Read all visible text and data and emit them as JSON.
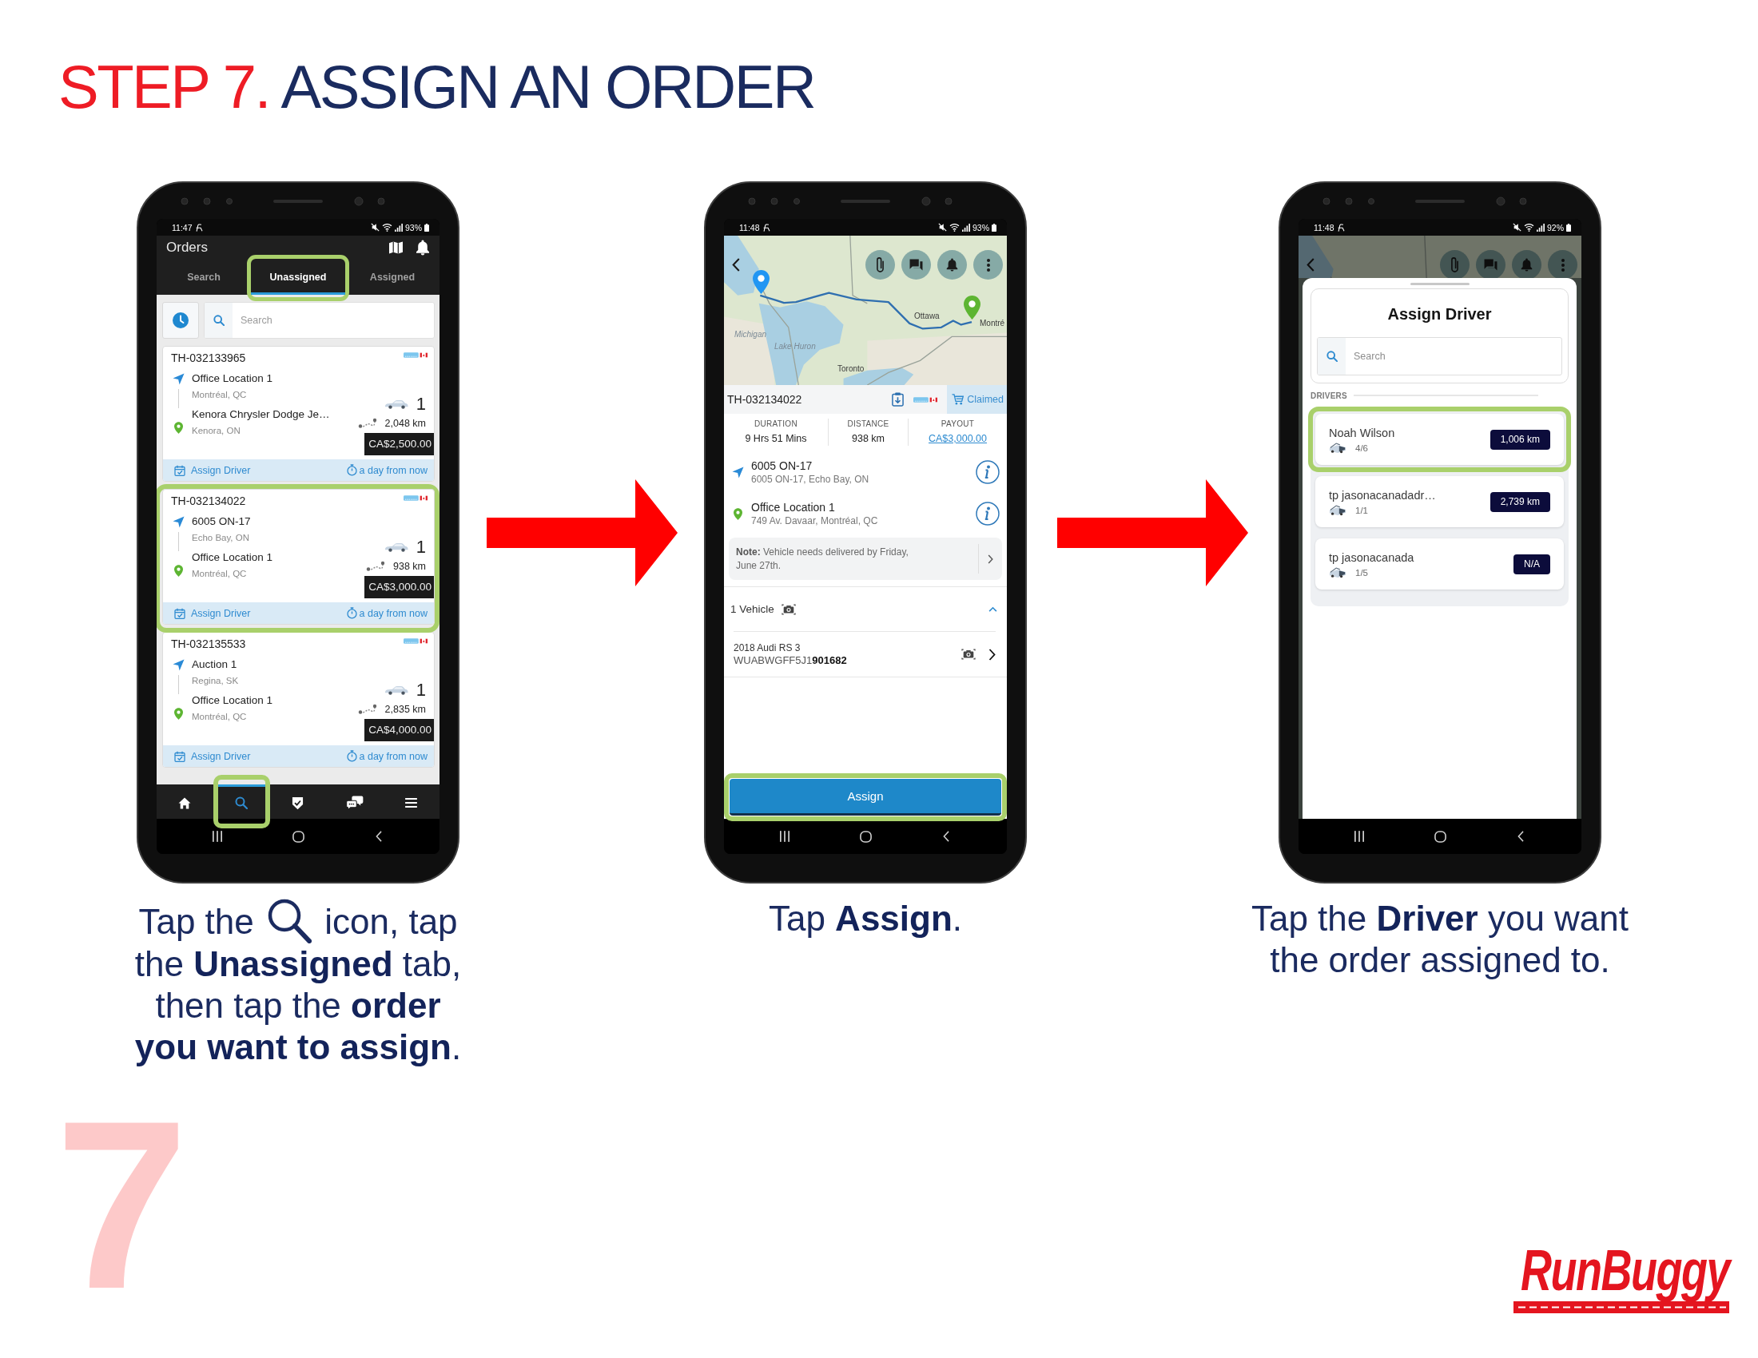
{
  "title": {
    "step": "STEP 7.",
    "text": "ASSIGN AN ORDER"
  },
  "phones": [
    {
      "kind": "orders",
      "status_bar": {
        "time": "11:47",
        "battery": "93%"
      },
      "header": {
        "title": "Orders"
      },
      "tabs": [
        {
          "label": "Search",
          "selected": false,
          "highlighted": false
        },
        {
          "label": "Unassigned",
          "selected": true,
          "highlighted": true
        },
        {
          "label": "Assigned",
          "selected": false,
          "highlighted": false
        }
      ],
      "search": {
        "placeholder": "Search"
      },
      "orders": [
        {
          "order_id": "TH-032133965",
          "pickup": {
            "name": "Office Location 1",
            "city": "Montréal, QC"
          },
          "dropoff": {
            "name": "Kenora Chrysler Dodge Je…",
            "city": "Kenora, ON"
          },
          "vehicle_count": "1",
          "distance": "2,048 km",
          "price": "CA$2,500.00",
          "action": "Assign Driver",
          "due": "a day from now",
          "highlighted": false
        },
        {
          "order_id": "TH-032134022",
          "pickup": {
            "name": "6005 ON-17",
            "city": "Echo Bay, ON"
          },
          "dropoff": {
            "name": "Office Location 1",
            "city": "Montréal, QC"
          },
          "vehicle_count": "1",
          "distance": "938 km",
          "price": "CA$3,000.00",
          "action": "Assign Driver",
          "due": "a day from now",
          "highlighted": true
        },
        {
          "order_id": "TH-032135533",
          "pickup": {
            "name": "Auction 1",
            "city": "Regina, SK"
          },
          "dropoff": {
            "name": "Office Location 1",
            "city": "Montréal, QC"
          },
          "vehicle_count": "1",
          "distance": "2,835 km",
          "price": "CA$4,000.00",
          "action": "Assign Driver",
          "due": "a day from now",
          "highlighted": false
        }
      ],
      "bottom_nav": [
        {
          "selected": false,
          "highlighted": false
        },
        {
          "selected": true,
          "highlighted": true
        },
        {
          "selected": false,
          "highlighted": false
        },
        {
          "selected": false,
          "highlighted": false
        },
        {
          "selected": false,
          "highlighted": false
        }
      ]
    },
    {
      "kind": "order_detail",
      "status_bar": {
        "time": "11:48",
        "battery": "93%"
      },
      "map": {
        "labels": [
          {
            "text": "Ottawa",
            "kind": "city"
          },
          {
            "text": "Montré",
            "kind": "city"
          },
          {
            "text": "Michigan",
            "kind": "region"
          },
          {
            "text": "Lake Huron",
            "kind": "region"
          },
          {
            "text": "Toronto",
            "kind": "city"
          }
        ]
      },
      "order": {
        "order_id": "TH-032134022",
        "status": "Claimed"
      },
      "stats": [
        {
          "label": "DURATION",
          "value": "9 Hrs 51 Mins",
          "kind": "text"
        },
        {
          "label": "DISTANCE",
          "value": "938 km",
          "kind": "text"
        },
        {
          "label": "PAYOUT",
          "value": "CA$3,000.00",
          "kind": "link"
        }
      ],
      "stops": [
        {
          "kind": "pickup",
          "name": "6005 ON-17",
          "address": "6005 ON-17, Echo Bay, ON"
        },
        {
          "kind": "dropoff",
          "name": "Office Location 1",
          "address": "749 Av. Davaar, Montréal, QC"
        }
      ],
      "note": "**Note:** Vehicle needs delivered by Friday, June 27th.",
      "vehicles": {
        "title": "1 Vehicle",
        "expanded": true,
        "items": [
          {
            "name": "2018 Audi RS 3",
            "vin": "WUABWGFF5J1**901682**"
          }
        ]
      },
      "assign_button": {
        "label": "Assign",
        "highlighted": true
      }
    },
    {
      "kind": "assign_driver",
      "status_bar": {
        "time": "11:48",
        "battery": "92%"
      },
      "sheet": {
        "title": "Assign Driver",
        "search": {
          "placeholder": "Search"
        },
        "section_label": "DRIVERS",
        "drivers": [
          {
            "name": "Noah Wilson",
            "load": "4/6",
            "distance": "1,006 km",
            "highlighted": true
          },
          {
            "name": "tp jasonacanadadr…",
            "load": "1/1",
            "distance": "2,739 km",
            "highlighted": false
          },
          {
            "name": "tp jasonacanada",
            "load": "1/5",
            "distance": "N/A",
            "highlighted": false
          }
        ]
      }
    }
  ],
  "captions": [
    {
      "kind": "with_icon",
      "before_icon": "Tap the",
      "after_icon": "icon, tap the **Unassigned** tab, then tap the **order you want to assign**."
    },
    {
      "kind": "plain",
      "text": "Tap **Assign**."
    },
    {
      "kind": "plain",
      "text": "Tap the **Driver** you want the order assigned to."
    }
  ],
  "step_number": "7",
  "logo": {
    "text": "RunBuggy"
  }
}
